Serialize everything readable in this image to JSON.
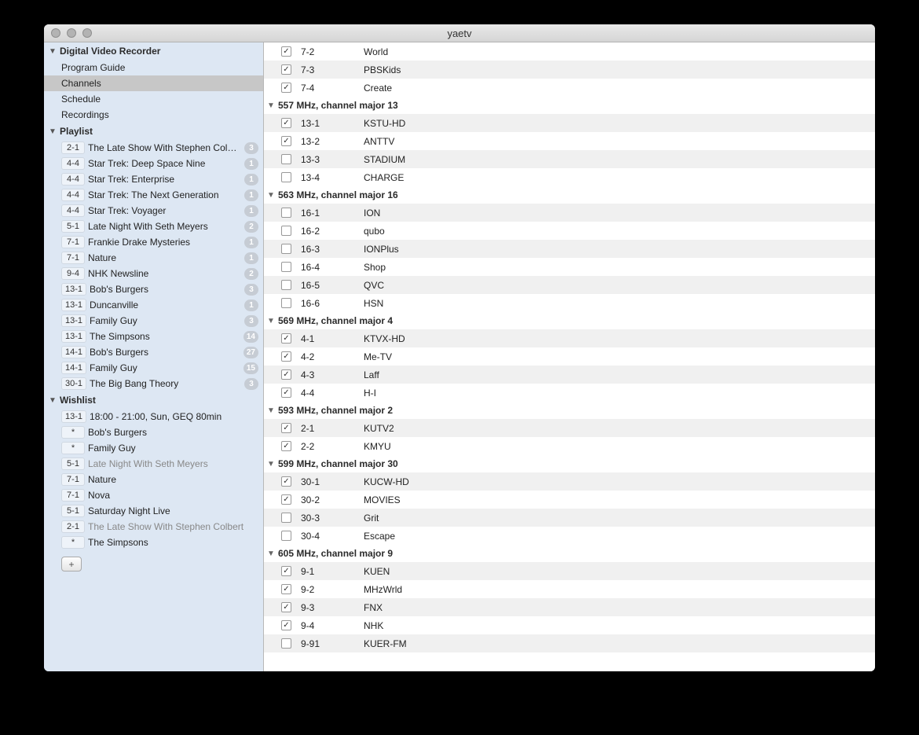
{
  "window": {
    "title": "yaetv"
  },
  "sidebar": {
    "sections": {
      "dvr": {
        "label": "Digital Video Recorder",
        "items": [
          {
            "label": "Program Guide",
            "selected": false
          },
          {
            "label": "Channels",
            "selected": true
          },
          {
            "label": "Schedule",
            "selected": false
          },
          {
            "label": "Recordings",
            "selected": false
          }
        ]
      },
      "playlist": {
        "label": "Playlist",
        "items": [
          {
            "chan": "2-1",
            "title": "The Late Show With Stephen Colbert",
            "count": "3"
          },
          {
            "chan": "4-4",
            "title": "Star Trek: Deep Space Nine",
            "count": "1"
          },
          {
            "chan": "4-4",
            "title": "Star Trek: Enterprise",
            "count": "1"
          },
          {
            "chan": "4-4",
            "title": "Star Trek: The Next Generation",
            "count": "1"
          },
          {
            "chan": "4-4",
            "title": "Star Trek: Voyager",
            "count": "1"
          },
          {
            "chan": "5-1",
            "title": "Late Night With Seth Meyers",
            "count": "2"
          },
          {
            "chan": "7-1",
            "title": "Frankie Drake Mysteries",
            "count": "1"
          },
          {
            "chan": "7-1",
            "title": "Nature",
            "count": "1"
          },
          {
            "chan": "9-4",
            "title": "NHK Newsline",
            "count": "2"
          },
          {
            "chan": "13-1",
            "title": "Bob's Burgers",
            "count": "3"
          },
          {
            "chan": "13-1",
            "title": "Duncanville",
            "count": "1"
          },
          {
            "chan": "13-1",
            "title": "Family Guy",
            "count": "3"
          },
          {
            "chan": "13-1",
            "title": "The Simpsons",
            "count": "14"
          },
          {
            "chan": "14-1",
            "title": "Bob's Burgers",
            "count": "27"
          },
          {
            "chan": "14-1",
            "title": "Family Guy",
            "count": "15"
          },
          {
            "chan": "30-1",
            "title": "The Big Bang Theory",
            "count": "3"
          }
        ]
      },
      "wishlist": {
        "label": "Wishlist",
        "items": [
          {
            "chan": "13-1",
            "title": "18:00 - 21:00, Sun, GEQ 80min",
            "dim": false
          },
          {
            "chan": "*",
            "title": "Bob's Burgers",
            "dim": false
          },
          {
            "chan": "*",
            "title": "Family Guy",
            "dim": false
          },
          {
            "chan": "5-1",
            "title": "Late Night With Seth Meyers",
            "dim": true
          },
          {
            "chan": "7-1",
            "title": "Nature",
            "dim": false
          },
          {
            "chan": "7-1",
            "title": "Nova",
            "dim": false
          },
          {
            "chan": "5-1",
            "title": "Saturday Night Live",
            "dim": false
          },
          {
            "chan": "2-1",
            "title": "The Late Show With Stephen Colbert",
            "dim": true
          },
          {
            "chan": "*",
            "title": "The Simpsons",
            "dim": false
          }
        ]
      }
    },
    "add_label": "+"
  },
  "channels": {
    "pre_rows": [
      {
        "num": "7-2",
        "name": "World",
        "checked": true,
        "alt": false
      },
      {
        "num": "7-3",
        "name": "PBSKids",
        "checked": true,
        "alt": true
      },
      {
        "num": "7-4",
        "name": "Create",
        "checked": true,
        "alt": false
      }
    ],
    "groups": [
      {
        "label": "557 MHz, channel major 13",
        "rows": [
          {
            "num": "13-1",
            "name": "KSTU-HD",
            "checked": true,
            "alt": true
          },
          {
            "num": "13-2",
            "name": "ANTTV",
            "checked": true,
            "alt": false
          },
          {
            "num": "13-3",
            "name": "STADIUM",
            "checked": false,
            "alt": true
          },
          {
            "num": "13-4",
            "name": "CHARGE",
            "checked": false,
            "alt": false
          }
        ]
      },
      {
        "label": "563 MHz, channel major 16",
        "rows": [
          {
            "num": "16-1",
            "name": "ION",
            "checked": false,
            "alt": true
          },
          {
            "num": "16-2",
            "name": "qubo",
            "checked": false,
            "alt": false
          },
          {
            "num": "16-3",
            "name": "IONPlus",
            "checked": false,
            "alt": true
          },
          {
            "num": "16-4",
            "name": "Shop",
            "checked": false,
            "alt": false
          },
          {
            "num": "16-5",
            "name": "QVC",
            "checked": false,
            "alt": true
          },
          {
            "num": "16-6",
            "name": "HSN",
            "checked": false,
            "alt": false
          }
        ]
      },
      {
        "label": "569 MHz, channel major 4",
        "rows": [
          {
            "num": "4-1",
            "name": "KTVX-HD",
            "checked": true,
            "alt": true
          },
          {
            "num": "4-2",
            "name": "Me-TV",
            "checked": true,
            "alt": false
          },
          {
            "num": "4-3",
            "name": "Laff",
            "checked": true,
            "alt": true
          },
          {
            "num": "4-4",
            "name": "H-I",
            "checked": true,
            "alt": false
          }
        ]
      },
      {
        "label": "593 MHz, channel major 2",
        "rows": [
          {
            "num": "2-1",
            "name": "KUTV2",
            "checked": true,
            "alt": true
          },
          {
            "num": "2-2",
            "name": "KMYU",
            "checked": true,
            "alt": false
          }
        ]
      },
      {
        "label": "599 MHz, channel major 30",
        "rows": [
          {
            "num": "30-1",
            "name": "KUCW-HD",
            "checked": true,
            "alt": true
          },
          {
            "num": "30-2",
            "name": "MOVIES",
            "checked": true,
            "alt": false
          },
          {
            "num": "30-3",
            "name": "Grit",
            "checked": false,
            "alt": true
          },
          {
            "num": "30-4",
            "name": "Escape",
            "checked": false,
            "alt": false
          }
        ]
      },
      {
        "label": "605 MHz, channel major 9",
        "rows": [
          {
            "num": "9-1",
            "name": "KUEN",
            "checked": true,
            "alt": true
          },
          {
            "num": "9-2",
            "name": "MHzWrld",
            "checked": true,
            "alt": false
          },
          {
            "num": "9-3",
            "name": "FNX",
            "checked": true,
            "alt": true
          },
          {
            "num": "9-4",
            "name": "NHK",
            "checked": true,
            "alt": false
          },
          {
            "num": "9-91",
            "name": "KUER-FM",
            "checked": false,
            "alt": true
          }
        ]
      }
    ]
  }
}
